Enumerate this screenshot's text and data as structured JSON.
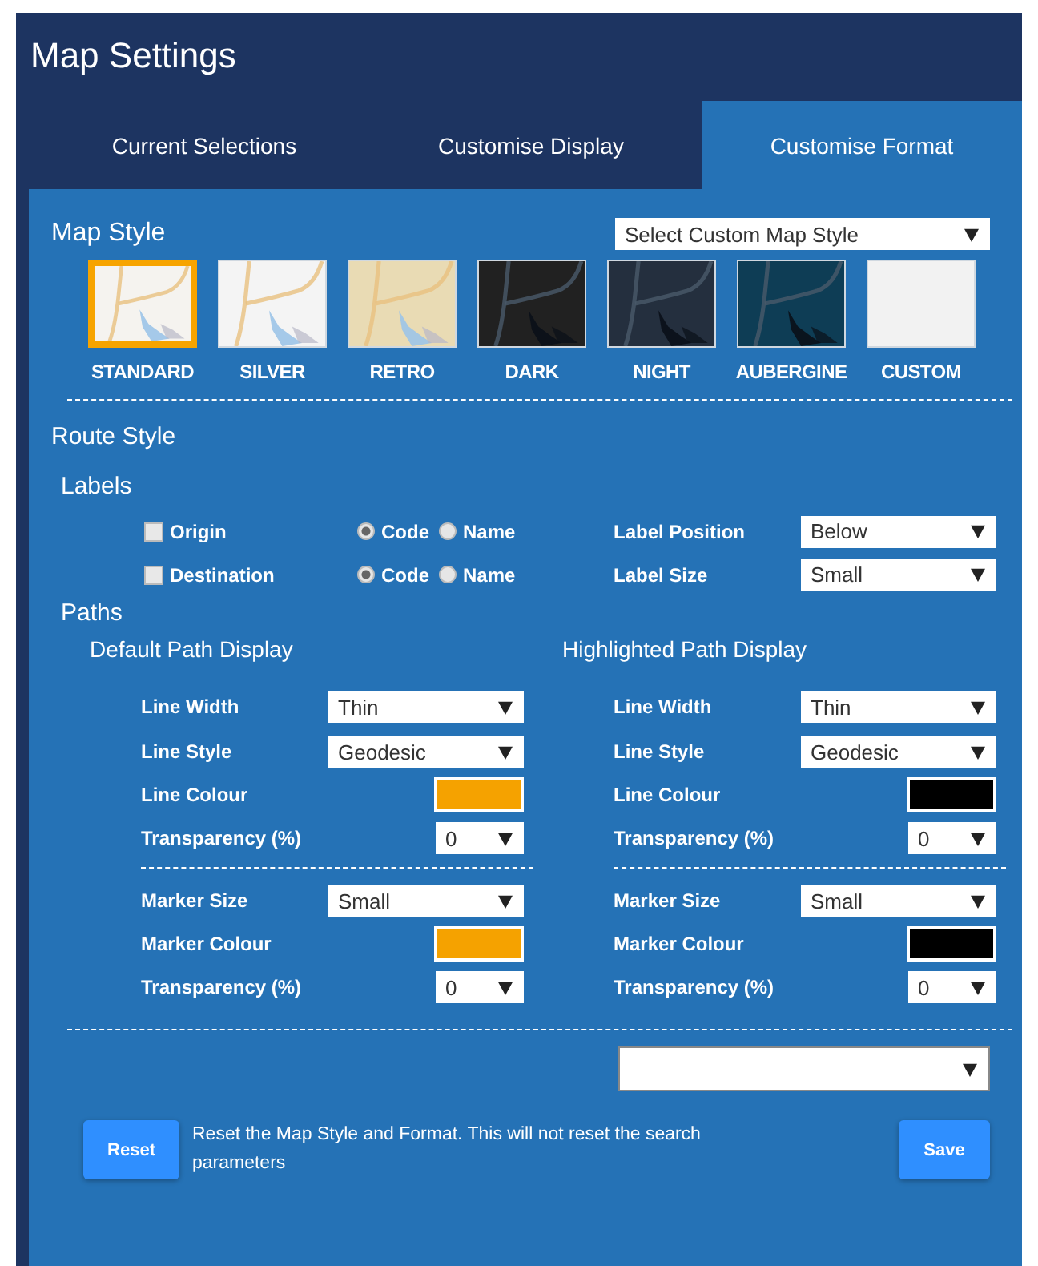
{
  "window": {
    "title": "Map Settings"
  },
  "tabs": [
    {
      "label": "Current Selections",
      "selected": false
    },
    {
      "label": "Customise Display",
      "selected": false
    },
    {
      "label": "Customise Format",
      "selected": true
    }
  ],
  "map_style": {
    "heading": "Map Style",
    "custom_select": {
      "value": "Select Custom Map Style"
    },
    "styles": [
      {
        "label": "STANDARD",
        "selected": true,
        "color": "#f5f3ef"
      },
      {
        "label": "SILVER",
        "selected": false,
        "color": "#f4f4f4"
      },
      {
        "label": "RETRO",
        "selected": false,
        "color": "#e9dbb4"
      },
      {
        "label": "DARK",
        "selected": false,
        "color": "#212121"
      },
      {
        "label": "NIGHT",
        "selected": false,
        "color": "#242f3e"
      },
      {
        "label": "AUBERGINE",
        "selected": false,
        "color": "#0e3d55"
      },
      {
        "label": "CUSTOM",
        "selected": false,
        "color": "#f2f2f2"
      }
    ]
  },
  "route_style": {
    "heading": "Route Style",
    "labels": {
      "heading": "Labels",
      "rows": [
        {
          "label": "Origin",
          "checked": false,
          "options": [
            {
              "label": "Code",
              "selected": true
            },
            {
              "label": "Name",
              "selected": false
            }
          ],
          "setting": "Label Position",
          "value": "Below"
        },
        {
          "label": "Destination",
          "checked": false,
          "options": [
            {
              "label": "Code",
              "selected": true
            },
            {
              "label": "Name",
              "selected": false
            }
          ],
          "setting": "Label Size",
          "value": "Small"
        }
      ]
    },
    "paths": {
      "heading": "Paths",
      "columns": [
        {
          "title": "Default Path Display",
          "groups": [
            [
              {
                "kind": "select",
                "label": "Line Width",
                "value": "Thin"
              },
              {
                "kind": "select",
                "label": "Line Style",
                "value": "Geodesic"
              },
              {
                "kind": "color",
                "label": "Line Colour",
                "color": "#f5a200"
              },
              {
                "kind": "small",
                "label": "Transparency (%)",
                "value": "0"
              }
            ],
            [
              {
                "kind": "select",
                "label": "Marker Size",
                "value": "Small"
              },
              {
                "kind": "color",
                "label": "Marker Colour",
                "color": "#f5a200"
              },
              {
                "kind": "small",
                "label": "Transparency (%)",
                "value": "0"
              }
            ]
          ]
        },
        {
          "title": "Highlighted Path Display",
          "groups": [
            [
              {
                "kind": "select",
                "label": "Line Width",
                "value": "Thin"
              },
              {
                "kind": "select",
                "label": "Line Style",
                "value": "Geodesic"
              },
              {
                "kind": "color",
                "label": "Line Colour",
                "color": "#000000"
              },
              {
                "kind": "small",
                "label": "Transparency (%)",
                "value": "0"
              }
            ],
            [
              {
                "kind": "select",
                "label": "Marker Size",
                "value": "Small"
              },
              {
                "kind": "color",
                "label": "Marker Colour",
                "color": "#000000"
              },
              {
                "kind": "small",
                "label": "Transparency (%)",
                "value": "0"
              }
            ]
          ]
        }
      ]
    }
  },
  "footer": {
    "reset_button": "Reset",
    "note": "Reset the Map Style and Format. This will not reset the search parameters",
    "save_button": "Save"
  }
}
